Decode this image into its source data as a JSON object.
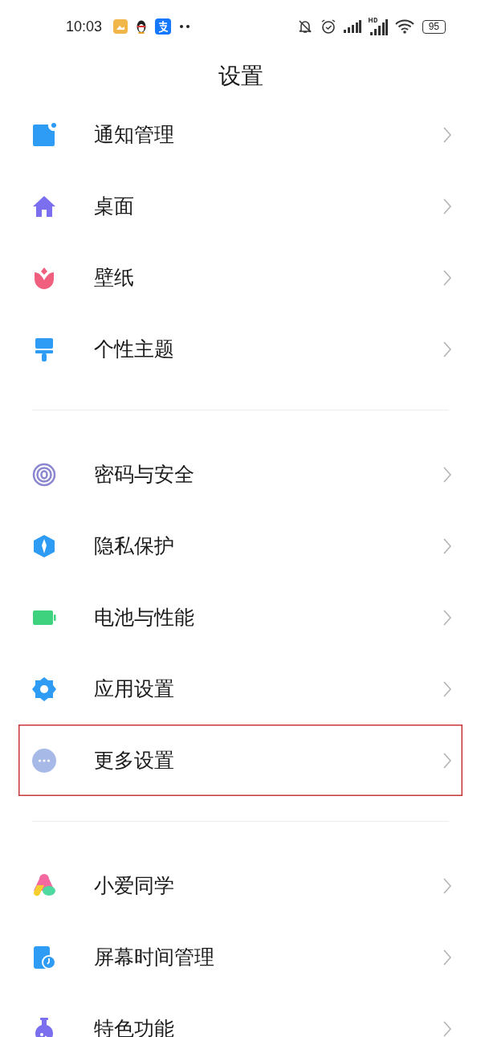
{
  "status_bar": {
    "time": "10:03",
    "battery": "95"
  },
  "title": "设置",
  "groups": [
    {
      "items": [
        {
          "label": "通知管理",
          "kind": "notice",
          "highlighted": false
        },
        {
          "label": "桌面",
          "kind": "home",
          "highlighted": false
        },
        {
          "label": "壁纸",
          "kind": "tulip",
          "highlighted": false
        },
        {
          "label": "个性主题",
          "kind": "brush",
          "highlighted": false
        }
      ]
    },
    {
      "items": [
        {
          "label": "密码与安全",
          "kind": "fingerprint",
          "highlighted": false
        },
        {
          "label": "隐私保护",
          "kind": "shield",
          "highlighted": false
        },
        {
          "label": "电池与性能",
          "kind": "battery",
          "highlighted": false
        },
        {
          "label": "应用设置",
          "kind": "gear",
          "highlighted": false
        },
        {
          "label": "更多设置",
          "kind": "more",
          "highlighted": true
        }
      ]
    },
    {
      "items": [
        {
          "label": "小爱同学",
          "kind": "assistant",
          "highlighted": false
        },
        {
          "label": "屏幕时间管理",
          "kind": "screentime",
          "highlighted": false
        },
        {
          "label": "特色功能",
          "kind": "flask",
          "highlighted": false
        }
      ]
    }
  ]
}
